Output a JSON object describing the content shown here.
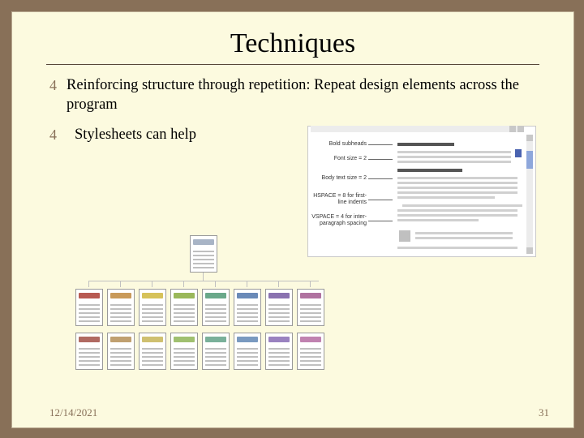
{
  "title": "Techniques",
  "bullets": [
    "Reinforcing structure through repetition: Repeat design elements across the program",
    "Stylesheets can help"
  ],
  "annotations": {
    "a0": "Bold subheads",
    "a1": "Font size = 2",
    "a2": "Body text size = 2",
    "a3": "HSPACE = 8 for first-line indents",
    "a4": "VSPACE = 4 for inter-paragraph spacing"
  },
  "footer": {
    "date": "12/14/2021",
    "page": "31"
  },
  "colors": {
    "row1": [
      "#b85a52",
      "#c99a5a",
      "#d6c25a",
      "#9ab85a",
      "#6aa88a",
      "#6a8ab8",
      "#8a72b0",
      "#b072a0"
    ],
    "row2": [
      "#b06a62",
      "#c0a070",
      "#cfc070",
      "#a0c070",
      "#7ab09a",
      "#7a9ac0",
      "#9a82c0",
      "#c082b0"
    ],
    "top": "#a8b4c6"
  }
}
